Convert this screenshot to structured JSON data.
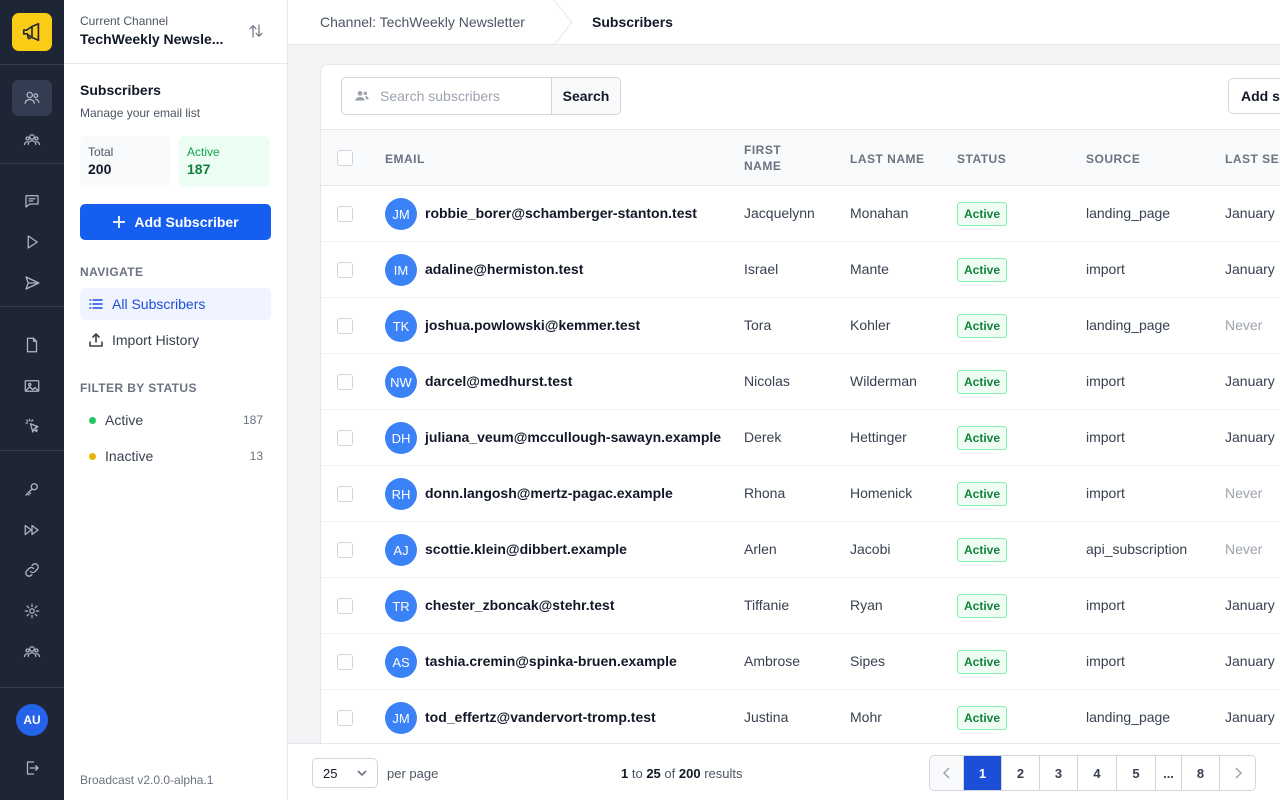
{
  "channel": {
    "label": "Current Channel",
    "name": "TechWeekly Newsle..."
  },
  "sidebar": {
    "title": "Subscribers",
    "subtitle": "Manage your email list",
    "stats": {
      "total_label": "Total",
      "total_value": "200",
      "active_label": "Active",
      "active_value": "187"
    },
    "add_button": "Add Subscriber",
    "navigate_heading": "NAVIGATE",
    "nav": [
      {
        "label": "All Subscribers"
      },
      {
        "label": "Import History"
      }
    ],
    "filter_heading": "FILTER BY STATUS",
    "filters": [
      {
        "label": "Active",
        "count": "187",
        "color": "#22c55e"
      },
      {
        "label": "Inactive",
        "count": "13",
        "color": "#eab308"
      }
    ],
    "version": "Broadcast v2.0.0-alpha.1"
  },
  "rail": {
    "avatar": "AU"
  },
  "breadcrumb": {
    "channel": "Channel: TechWeekly Newsletter",
    "current": "Subscribers"
  },
  "search": {
    "placeholder": "Search subscribers",
    "button": "Search"
  },
  "add_sub_button": "Add subscriber",
  "table": {
    "headers": {
      "email": "EMAIL",
      "first_name_1": "FIRST",
      "first_name_2": "NAME",
      "last_name": "LAST NAME",
      "status": "STATUS",
      "source": "SOURCE",
      "last_sent": "LAST SENT"
    },
    "rows": [
      {
        "initials": "JM",
        "email": "robbie_borer@schamberger-stanton.test",
        "first": "Jacquelynn",
        "last": "Monahan",
        "status": "Active",
        "source": "landing_page",
        "last_sent": "January"
      },
      {
        "initials": "IM",
        "email": "adaline@hermiston.test",
        "first": "Israel",
        "last": "Mante",
        "status": "Active",
        "source": "import",
        "last_sent": "January"
      },
      {
        "initials": "TK",
        "email": "joshua.powlowski@kemmer.test",
        "first": "Tora",
        "last": "Kohler",
        "status": "Active",
        "source": "landing_page",
        "last_sent": "Never"
      },
      {
        "initials": "NW",
        "email": "darcel@medhurst.test",
        "first": "Nicolas",
        "last": "Wilderman",
        "status": "Active",
        "source": "import",
        "last_sent": "January"
      },
      {
        "initials": "DH",
        "email": "juliana_veum@mccullough-sawayn.example",
        "first": "Derek",
        "last": "Hettinger",
        "status": "Active",
        "source": "import",
        "last_sent": "January"
      },
      {
        "initials": "RH",
        "email": "donn.langosh@mertz-pagac.example",
        "first": "Rhona",
        "last": "Homenick",
        "status": "Active",
        "source": "import",
        "last_sent": "Never"
      },
      {
        "initials": "AJ",
        "email": "scottie.klein@dibbert.example",
        "first": "Arlen",
        "last": "Jacobi",
        "status": "Active",
        "source": "api_subscription",
        "last_sent": "Never"
      },
      {
        "initials": "TR",
        "email": "chester_zboncak@stehr.test",
        "first": "Tiffanie",
        "last": "Ryan",
        "status": "Active",
        "source": "import",
        "last_sent": "January"
      },
      {
        "initials": "AS",
        "email": "tashia.cremin@spinka-bruen.example",
        "first": "Ambrose",
        "last": "Sipes",
        "status": "Active",
        "source": "import",
        "last_sent": "January"
      },
      {
        "initials": "JM",
        "email": "tod_effertz@vandervort-tromp.test",
        "first": "Justina",
        "last": "Mohr",
        "status": "Active",
        "source": "landing_page",
        "last_sent": "January"
      }
    ]
  },
  "footer": {
    "per_page_value": "25",
    "per_page_label": "per page",
    "results": {
      "from": "1",
      "to_word": "to",
      "to": "25",
      "of_word": "of",
      "total": "200",
      "suffix": "results"
    },
    "pages": [
      "1",
      "2",
      "3",
      "4",
      "5",
      "...",
      "8"
    ],
    "current_page": "1"
  }
}
